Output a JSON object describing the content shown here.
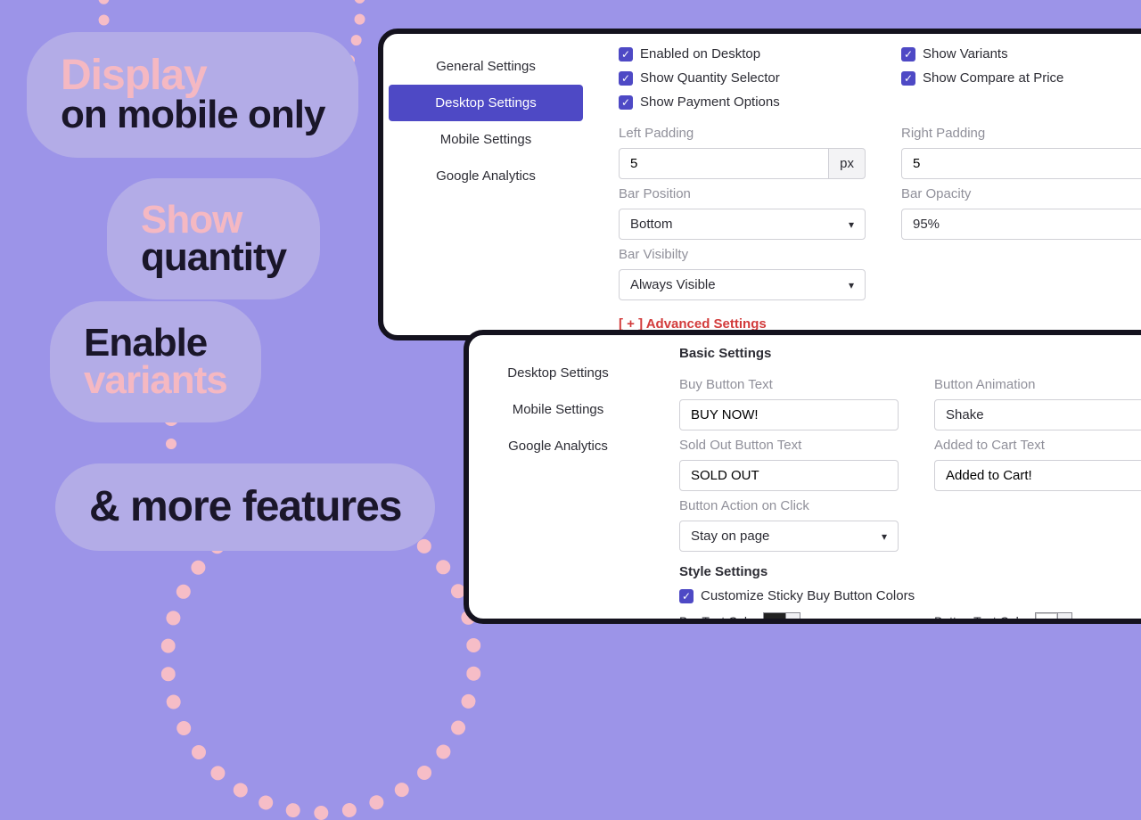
{
  "pills": {
    "display": {
      "l1": "Display",
      "l2": "on mobile only"
    },
    "quantity": {
      "l1": "Show",
      "l2": "quantity"
    },
    "variants": {
      "l1": "Enable",
      "l2": "variants"
    },
    "more": {
      "l1": "& more features"
    }
  },
  "panel1": {
    "nav": {
      "general": "General Settings",
      "desktop": "Desktop Settings",
      "mobile": "Mobile Settings",
      "analytics": "Google Analytics"
    },
    "checks": {
      "desktop": "Enabled on Desktop",
      "qty": "Show Quantity Selector",
      "pay": "Show Payment Options",
      "variants": "Show Variants",
      "compare": "Show Compare at Price"
    },
    "labels": {
      "lpad": "Left Padding",
      "rpad": "Right Padding",
      "barpos": "Bar Position",
      "baropa": "Bar Opacity",
      "barvis": "Bar Visibilty"
    },
    "values": {
      "lpad": "5",
      "lpad_unit": "px",
      "rpad": "5",
      "barpos": "Bottom",
      "baropa": "95%",
      "barvis": "Always Visible"
    },
    "advanced": "[ + ] Advanced Settings"
  },
  "panel2": {
    "nav": {
      "desktop": "Desktop Settings",
      "mobile": "Mobile Settings",
      "analytics": "Google Analytics"
    },
    "section_basic": "Basic Settings",
    "section_style": "Style Settings",
    "labels": {
      "buybtn": "Buy Button Text",
      "anim": "Button Animation",
      "soldout": "Sold Out Button Text",
      "added": "Added to Cart Text",
      "action": "Button Action on Click",
      "bartxt": "Bar Text Color",
      "btntxt": "Button Text Color"
    },
    "values": {
      "buybtn": "BUY NOW!",
      "anim": "Shake",
      "soldout": "SOLD OUT",
      "added": "Added to Cart!",
      "action": "Stay on page"
    },
    "customize": "Customize Sticky Buy Button Colors",
    "colors": {
      "bar": "#222222",
      "btn": "#ffffff"
    }
  }
}
